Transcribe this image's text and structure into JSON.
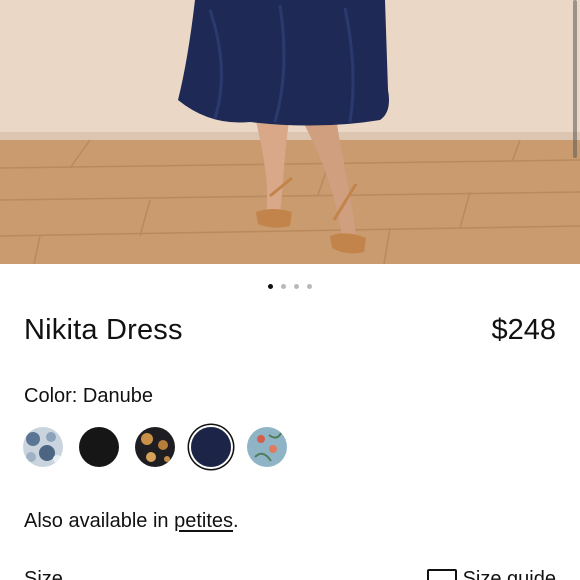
{
  "product": {
    "title": "Nikita Dress",
    "price": "$248",
    "image_alt": "Model wearing navy midi dress with tan strappy sandals on wood floor"
  },
  "carousel": {
    "count": 4,
    "active": 0
  },
  "color": {
    "label": "Color: Danube",
    "swatches": [
      {
        "name": "blue-floral-print",
        "color": "#a9b8c6"
      },
      {
        "name": "black",
        "color": "#161616"
      },
      {
        "name": "black-gold-floral",
        "color": "#1e1d22"
      },
      {
        "name": "danube-navy",
        "color": "#1c2547",
        "selected": true
      },
      {
        "name": "light-blue-floral",
        "color": "#8fb4c5"
      }
    ]
  },
  "availability": {
    "prefix": "Also available in ",
    "link": "petites",
    "suffix": "."
  },
  "size": {
    "label": "Size",
    "guide_label": "Size guide"
  }
}
